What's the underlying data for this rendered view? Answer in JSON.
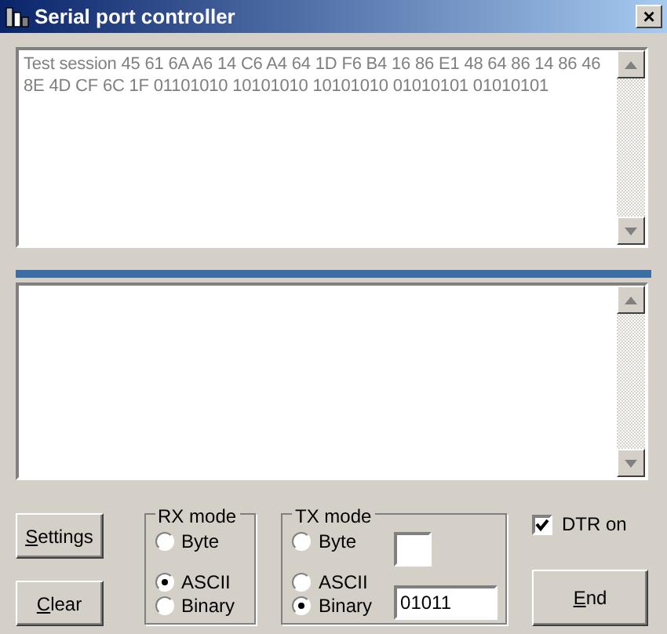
{
  "window": {
    "title": "Serial port controller",
    "close": "×"
  },
  "rx_log": {
    "value": "Test session 45 61 6A A6 14 C6 A4 64 1D F6 B4 16 86 E1 48 64 86 14 86 46 8E 4D CF 6C 1F 01101010 10101010 10101010 01010101 01010101",
    "disabled": true
  },
  "buttons_left": [
    {
      "label": "Settings"
    },
    {
      "label": "Clear"
    }
  ],
  "rx_mode": {
    "title": "RX mode",
    "options": [
      {
        "label": "Byte",
        "selected": false
      },
      {
        "label": "ASCII",
        "selected": true
      },
      {
        "label": "Binary",
        "selected": false
      }
    ]
  },
  "tx_mode": {
    "title": "TX mode",
    "options": [
      {
        "label": "Byte",
        "selected": false
      },
      {
        "label": "ASCII",
        "selected": false
      },
      {
        "label": "Binary",
        "selected": true
      }
    ],
    "binary_value": "01011"
  },
  "dtr": {
    "label": "DTR on",
    "checked": true
  },
  "end_button": {
    "label": "End"
  }
}
